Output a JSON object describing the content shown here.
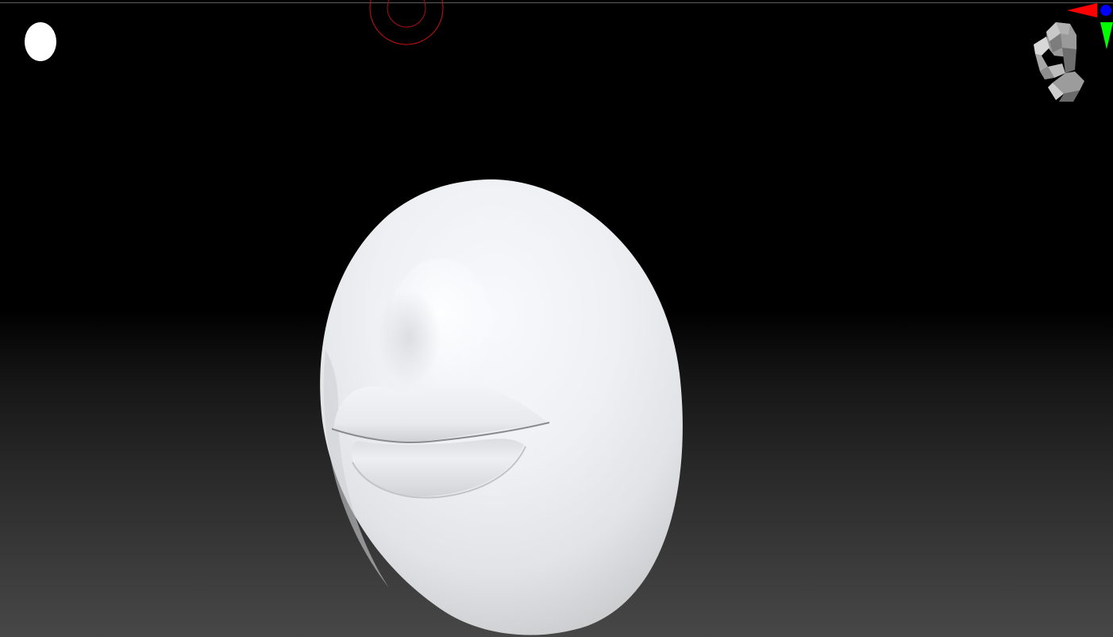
{
  "canvas": {
    "background_top": "#000000",
    "background_bottom": "#474747"
  },
  "material_indicator": {
    "color": "#ffffff"
  },
  "brush_cursor": {
    "color": "#cc1111"
  },
  "model": {
    "material_color": "#f2f4f8"
  },
  "navigation_gizmo": {
    "icon": "head-icon",
    "axes": [
      {
        "axis": "x",
        "color": "#ff0000",
        "icon": "x-axis-arrow-icon"
      },
      {
        "axis": "y",
        "color": "#00ff00",
        "icon": "y-axis-arrow-icon"
      },
      {
        "axis": "z",
        "color": "#0000ff",
        "icon": "z-axis-dot-icon"
      }
    ]
  }
}
